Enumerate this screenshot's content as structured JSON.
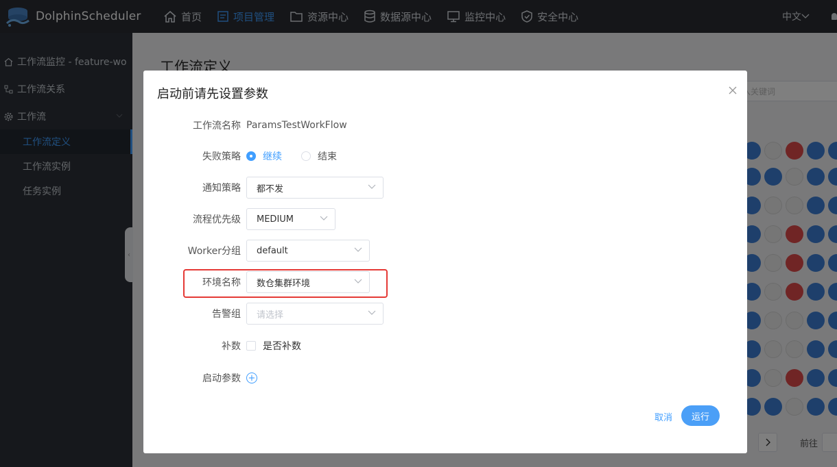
{
  "app": {
    "name": "DolphinScheduler"
  },
  "topnav": {
    "items": [
      {
        "label": "首页",
        "icon": "home-icon",
        "active": false
      },
      {
        "label": "项目管理",
        "icon": "project-icon",
        "active": true
      },
      {
        "label": "资源中心",
        "icon": "folder-icon",
        "active": false
      },
      {
        "label": "数据源中心",
        "icon": "database-icon",
        "active": false
      },
      {
        "label": "监控中心",
        "icon": "monitor-icon",
        "active": false
      },
      {
        "label": "安全中心",
        "icon": "shield-icon",
        "active": false
      }
    ],
    "language": "中文"
  },
  "sidebar": {
    "items": [
      {
        "label": "工作流监控 - feature-wo",
        "icon": "home-icon"
      },
      {
        "label": "工作流关系",
        "icon": "tree-icon"
      },
      {
        "label": "工作流",
        "icon": "gear-icon"
      }
    ],
    "sub_items": [
      {
        "label": "工作流定义",
        "active": true
      },
      {
        "label": "工作流实例",
        "active": false
      },
      {
        "label": "任务实例",
        "active": false
      }
    ]
  },
  "page": {
    "title": "工作流定义",
    "search_placeholder": "入关键词",
    "goto_label": "前往"
  },
  "modal": {
    "title": "启动前请先设置参数",
    "fields": {
      "workflow_name_label": "工作流名称",
      "workflow_name_value": "ParamsTestWorkFlow",
      "failure_strategy_label": "失败策略",
      "failure_options": [
        "继续",
        "结束"
      ],
      "failure_selected": "继续",
      "notify_strategy_label": "通知策略",
      "notify_strategy_value": "都不发",
      "priority_label": "流程优先级",
      "priority_value": "MEDIUM",
      "worker_group_label": "Worker分组",
      "worker_group_value": "default",
      "env_label": "环境名称",
      "env_value": "数仓集群环境",
      "alert_group_label": "告警组",
      "alert_group_placeholder": "请选择",
      "complement_label": "补数",
      "complement_checkbox_label": "是否补数",
      "startup_params_label": "启动参数"
    },
    "cancel_label": "取消",
    "run_label": "运行"
  },
  "colors": {
    "accent": "#409eff",
    "topbar": "#2a2d33",
    "sidebar": "#2c3138",
    "highlight": "#e53935"
  }
}
